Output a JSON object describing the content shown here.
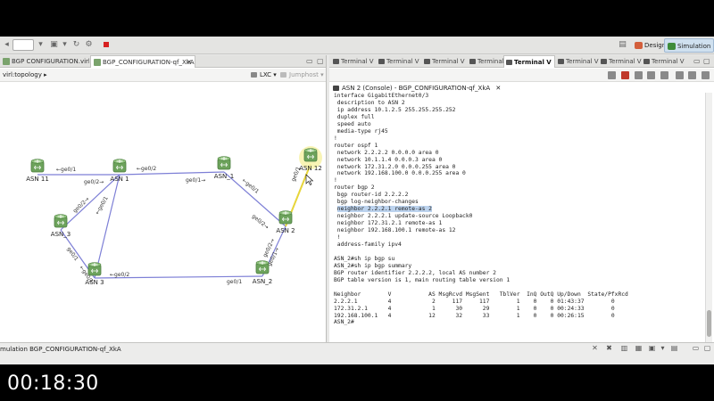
{
  "colors": {
    "router_green": "#6da35c",
    "link_purple": "#7d7fd6",
    "selected_link": "#e7d53a",
    "selection_highlight": "#bcd3ee"
  },
  "toolbar": {
    "perspective_design": "Design",
    "perspective_simulation": "Simulation"
  },
  "left": {
    "tabs": [
      "BGP CONFIGURATION.virl",
      "BGP_CONFIGURATION-qf_XkA"
    ],
    "topology_label": "virl:topology",
    "lxc_label": "LXC",
    "jumphost_label": "Jumphost",
    "nodes": {
      "asn11": "ASN 11",
      "asn1": "ASN 1",
      "asn_1": "ASN_1",
      "asn12": "ASN 12",
      "asn_3": "ASN_3",
      "asn2": "ASN 2",
      "asn3": "ASN 3",
      "asn_2": "ASN_2"
    },
    "interfaces": {
      "i1": "←ge0/1",
      "i2": "←ge0/2",
      "i3": "ge0/1→",
      "i4": "←ge0/1",
      "i5": "ge0/1",
      "i6": "ge0/2→",
      "i7": "ge0/2→",
      "i8": "←ge0/1",
      "i9": "ge0/1",
      "i10": "←ge0/1",
      "i11": "ge0/2→",
      "i12": "ge0/2→",
      "i13": "ge0/1→",
      "i14": "←ge0/2",
      "i15": "ge0/1"
    }
  },
  "right": {
    "terminal_tab_label": "Terminal V",
    "console_title": "ASN 2 (Console) - BGP_CONFIGURATION-qf_XkA",
    "lines_top": [
      "interface GigabitEthernet0/3",
      " description to ASN 2",
      " ip address 10.1.2.5 255.255.255.252",
      " duplex full",
      " speed auto",
      " media-type rj45",
      "!",
      "router ospf 1",
      " network 2.2.2.2 0.0.0.0 area 0",
      " network 10.1.1.4 0.0.0.3 area 0",
      " network 172.31.2.0 0.0.0.255 area 0",
      " network 192.168.100.0 0.0.0.255 area 0",
      "!",
      "router bgp 2",
      " bgp router-id 2.2.2.2",
      " bgp log-neighbor-changes"
    ],
    "selected_line_prefix": " ",
    "selected_line_text": "neighbor 2.2.2.1 remote-as 2",
    "lines_bottom": [
      " neighbor 2.2.2.1 update-source Loopback0",
      " neighbor 172.31.2.1 remote-as 1",
      " neighbor 192.168.100.1 remote-as 12",
      " !",
      " address-family ipv4",
      "",
      "ASN_2#sh ip bgp su",
      "ASN_2#sh ip bgp summary",
      "BGP router identifier 2.2.2.2, local AS number 2",
      "BGP table version is 1, main routing table version 1",
      "",
      "Neighbor        V           AS MsgRcvd MsgSent   TblVer  InQ OutQ Up/Down  State/PfxRcd",
      "2.2.2.1         4            2     117     117        1    0    0 01:43:37        0",
      "172.31.2.1      4            1      30      29        1    0    0 00:24:33        0",
      "192.168.100.1   4           12      32      33        1    0    0 00:26:15        0",
      "ASN_2#"
    ]
  },
  "bottom": {
    "title": "mulation BGP_CONFIGURATION-qf_XkA"
  },
  "timer": "00:18:30"
}
